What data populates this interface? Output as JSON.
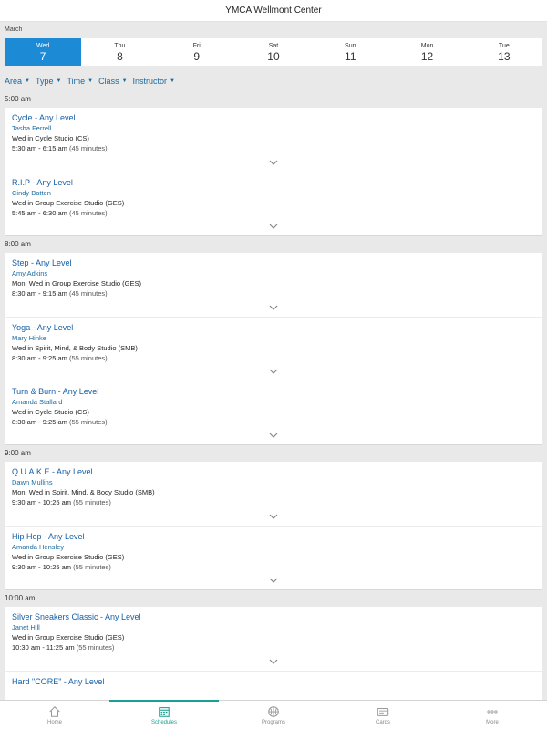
{
  "app": {
    "title": "YMCA Wellmont Center"
  },
  "calendar": {
    "month": "March",
    "days": [
      {
        "name": "Wed",
        "num": "7"
      },
      {
        "name": "Thu",
        "num": "8"
      },
      {
        "name": "Fri",
        "num": "9"
      },
      {
        "name": "Sat",
        "num": "10"
      },
      {
        "name": "Sun",
        "num": "11"
      },
      {
        "name": "Mon",
        "num": "12"
      },
      {
        "name": "Tue",
        "num": "13"
      }
    ]
  },
  "filters": [
    "Area",
    "Type",
    "Time",
    "Class",
    "Instructor"
  ],
  "schedule": [
    {
      "time": "5:00 am",
      "classes": [
        {
          "name": "Cycle - Any Level",
          "instructor": "Tasha Ferrell",
          "location": "Wed in Cycle Studio (CS)",
          "time": "5:30 am - 6:15 am",
          "duration": "(45 minutes)"
        },
        {
          "name": "R.I.P - Any Level",
          "instructor": "Cindy Batten",
          "location": "Wed in Group Exercise Studio (GES)",
          "time": "5:45 am - 6:30 am",
          "duration": "(45 minutes)"
        }
      ]
    },
    {
      "time": "8:00 am",
      "classes": [
        {
          "name": "Step - Any Level",
          "instructor": "Amy Adkins",
          "location": "Mon, Wed in Group Exercise Studio (GES)",
          "time": "8:30 am - 9:15 am",
          "duration": "(45 minutes)"
        },
        {
          "name": "Yoga - Any Level",
          "instructor": "Mary Hinke",
          "location": "Wed in Spirit, Mind, & Body Studio (SMB)",
          "time": "8:30 am - 9:25 am",
          "duration": "(55 minutes)"
        },
        {
          "name": "Turn & Burn - Any Level",
          "instructor": "Amanda Stallard",
          "location": "Wed in Cycle Studio (CS)",
          "time": "8:30 am - 9:25 am",
          "duration": "(55 minutes)"
        }
      ]
    },
    {
      "time": "9:00 am",
      "classes": [
        {
          "name": "Q.U.A.K.E - Any Level",
          "instructor": "Dawn Mullins",
          "location": "Mon, Wed in Spirit, Mind, & Body Studio (SMB)",
          "time": "9:30 am - 10:25 am",
          "duration": "(55 minutes)"
        },
        {
          "name": "Hip Hop - Any Level",
          "instructor": "Amanda Hensley",
          "location": "Wed in Group Exercise Studio (GES)",
          "time": "9:30 am - 10:25 am",
          "duration": "(55 minutes)"
        }
      ]
    },
    {
      "time": "10:00 am",
      "classes": [
        {
          "name": "Silver Sneakers Classic - Any Level",
          "instructor": "Janet Hill",
          "location": "Wed in Group Exercise Studio (GES)",
          "time": "10:30 am - 11:25 am",
          "duration": "(55 minutes)"
        },
        {
          "name": "Hard \"CORE\" - Any Level",
          "instructor": "",
          "location": "",
          "time": "",
          "duration": ""
        }
      ]
    }
  ],
  "tabs": [
    {
      "label": "Home",
      "icon": "home-icon"
    },
    {
      "label": "Schedules",
      "icon": "calendar-icon"
    },
    {
      "label": "Programs",
      "icon": "basketball-icon"
    },
    {
      "label": "Cards",
      "icon": "card-icon"
    },
    {
      "label": "More",
      "icon": "more-dots-icon"
    }
  ],
  "colors": {
    "accent": "#1d8ad6",
    "link": "#1560a8",
    "tab_active": "#1aa090"
  }
}
